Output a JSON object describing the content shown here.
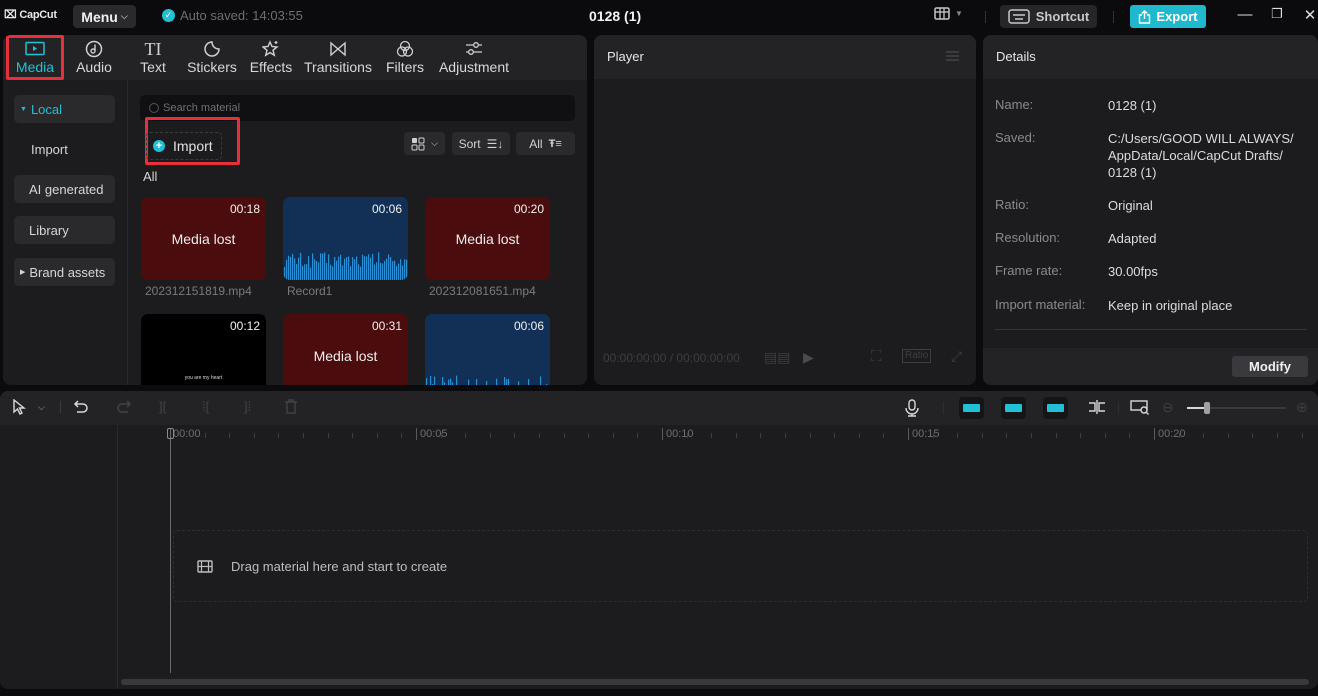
{
  "titlebar": {
    "logo": "CapCut",
    "menu_label": "Menu",
    "autosave": "Auto saved: 14:03:55",
    "project_title": "0128 (1)",
    "shortcut_label": "Shortcut",
    "export_label": "Export"
  },
  "media_tabs": [
    {
      "label": "Media",
      "icon": "media-icon",
      "active": true
    },
    {
      "label": "Audio",
      "icon": "audio-icon"
    },
    {
      "label": "Text",
      "icon": "text-icon"
    },
    {
      "label": "Stickers",
      "icon": "stickers-icon"
    },
    {
      "label": "Effects",
      "icon": "effects-icon"
    },
    {
      "label": "Transitions",
      "icon": "transitions-icon"
    },
    {
      "label": "Filters",
      "icon": "filters-icon"
    },
    {
      "label": "Adjustment",
      "icon": "adjustment-icon"
    }
  ],
  "sidebar": {
    "items": [
      {
        "label": "Local",
        "active": true
      },
      {
        "label": "Import"
      },
      {
        "label": "AI generated"
      },
      {
        "label": "Library"
      },
      {
        "label": "Brand assets"
      }
    ]
  },
  "media": {
    "search_placeholder": "Search material",
    "import_label": "Import",
    "sort_label": "Sort",
    "filter_label": "All",
    "section_label": "All",
    "items": [
      {
        "type": "lost",
        "duration": "00:18",
        "status": "Media lost",
        "filename": "202312151819.mp4"
      },
      {
        "type": "audio",
        "duration": "00:06",
        "filename": "Record1"
      },
      {
        "type": "lost",
        "duration": "00:20",
        "status": "Media lost",
        "filename": "202312081651.mp4"
      },
      {
        "type": "video",
        "duration": "00:12",
        "caption": "you are my heart"
      },
      {
        "type": "lost",
        "duration": "00:31",
        "status": "Media lost"
      },
      {
        "type": "audio",
        "duration": "00:06"
      }
    ]
  },
  "player": {
    "title": "Player",
    "current_time": "00:00:00:00",
    "total_time": "00:00:00:00",
    "ratio_label": "Ratio"
  },
  "details": {
    "title": "Details",
    "rows": [
      {
        "label": "Name:",
        "value": "0128 (1)"
      },
      {
        "label": "Saved:",
        "value": "C:/Users/GOOD WILL ALWAYS/ AppData/Local/CapCut Drafts/ 0128 (1)"
      },
      {
        "label": "Ratio:",
        "value": "Original"
      },
      {
        "label": "Resolution:",
        "value": "Adapted"
      },
      {
        "label": "Frame rate:",
        "value": "30.00fps"
      },
      {
        "label": "Import material:",
        "value": "Keep in original place"
      }
    ],
    "modify_label": "Modify"
  },
  "timeline": {
    "ruler_labels": [
      "00:00",
      "00:05",
      "00:10",
      "00:15",
      "00:20"
    ],
    "drop_hint": "Drag material here and start to create",
    "zoom_level": 0.2
  },
  "colors": {
    "accent": "#22c0d4",
    "highlight": "#e8303c",
    "media_lost_bg": "#4a0c0c",
    "audio_bg": "#123056"
  }
}
